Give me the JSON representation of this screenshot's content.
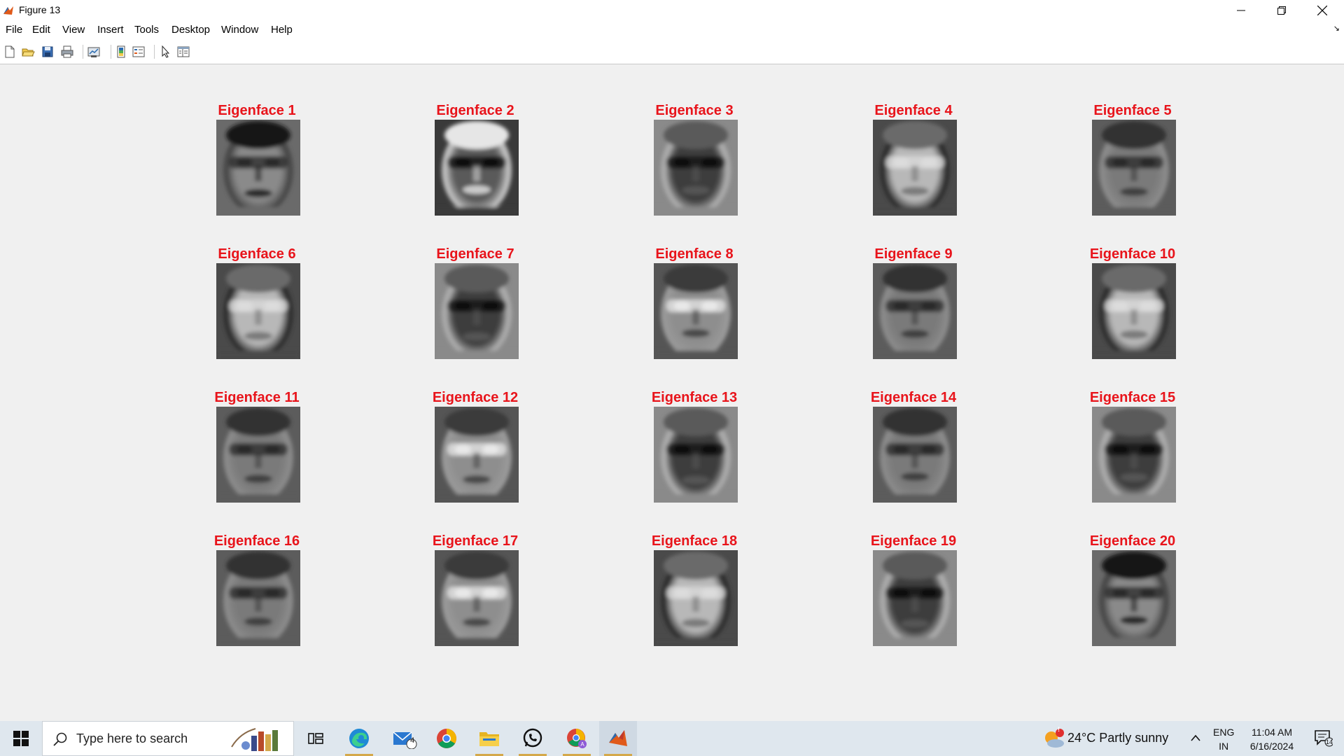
{
  "window": {
    "title": "Figure 13",
    "minimize_icon": "minimize-icon",
    "maximize_icon": "restore-icon",
    "close_icon": "close-icon"
  },
  "menu": {
    "items": [
      "File",
      "Edit",
      "View",
      "Insert",
      "Tools",
      "Desktop",
      "Window",
      "Help"
    ],
    "dock_arrow": "↘"
  },
  "toolbar": {
    "icons": [
      "new-figure-icon",
      "open-file-icon",
      "save-icon",
      "print-icon",
      "link-plot-icon",
      "insert-colorbar-icon",
      "insert-legend-icon",
      "pointer-icon",
      "property-inspector-icon"
    ]
  },
  "figure": {
    "title_color": "#e8141b",
    "panels": [
      {
        "title": "Eigenface 1",
        "style": "dark-top"
      },
      {
        "title": "Eigenface 2",
        "style": "bright-halo"
      },
      {
        "title": "Eigenface 3",
        "style": "dark-center"
      },
      {
        "title": "Eigenface 4",
        "style": "bright-face"
      },
      {
        "title": "Eigenface 5",
        "style": "mid"
      },
      {
        "title": "Eigenface 6",
        "style": "bright-face"
      },
      {
        "title": "Eigenface 7",
        "style": "dark-center"
      },
      {
        "title": "Eigenface 8",
        "style": "bright-band"
      },
      {
        "title": "Eigenface 9",
        "style": "mid"
      },
      {
        "title": "Eigenface 10",
        "style": "bright-face"
      },
      {
        "title": "Eigenface 11",
        "style": "mid"
      },
      {
        "title": "Eigenface 12",
        "style": "bright-band"
      },
      {
        "title": "Eigenface 13",
        "style": "dark-center"
      },
      {
        "title": "Eigenface 14",
        "style": "mid"
      },
      {
        "title": "Eigenface 15",
        "style": "dark-center"
      },
      {
        "title": "Eigenface 16",
        "style": "mid"
      },
      {
        "title": "Eigenface 17",
        "style": "bright-band"
      },
      {
        "title": "Eigenface 18",
        "style": "bright-face"
      },
      {
        "title": "Eigenface 19",
        "style": "dark-center"
      },
      {
        "title": "Eigenface 20",
        "style": "dark-top"
      }
    ]
  },
  "taskbar": {
    "search_placeholder": "Type here to search",
    "apps": [
      "task-view-icon",
      "edge-icon",
      "mail-icon",
      "chrome-icon",
      "file-explorer-icon",
      "whatsapp-icon",
      "chrome-profile-icon",
      "matlab-icon"
    ],
    "mail_badge": "4",
    "weather": "24°C  Partly sunny",
    "weather_badge": "!",
    "lang_line1": "ENG",
    "lang_line2": "IN",
    "time": "11:04 AM",
    "date": "6/16/2024",
    "notification_count": "14"
  }
}
